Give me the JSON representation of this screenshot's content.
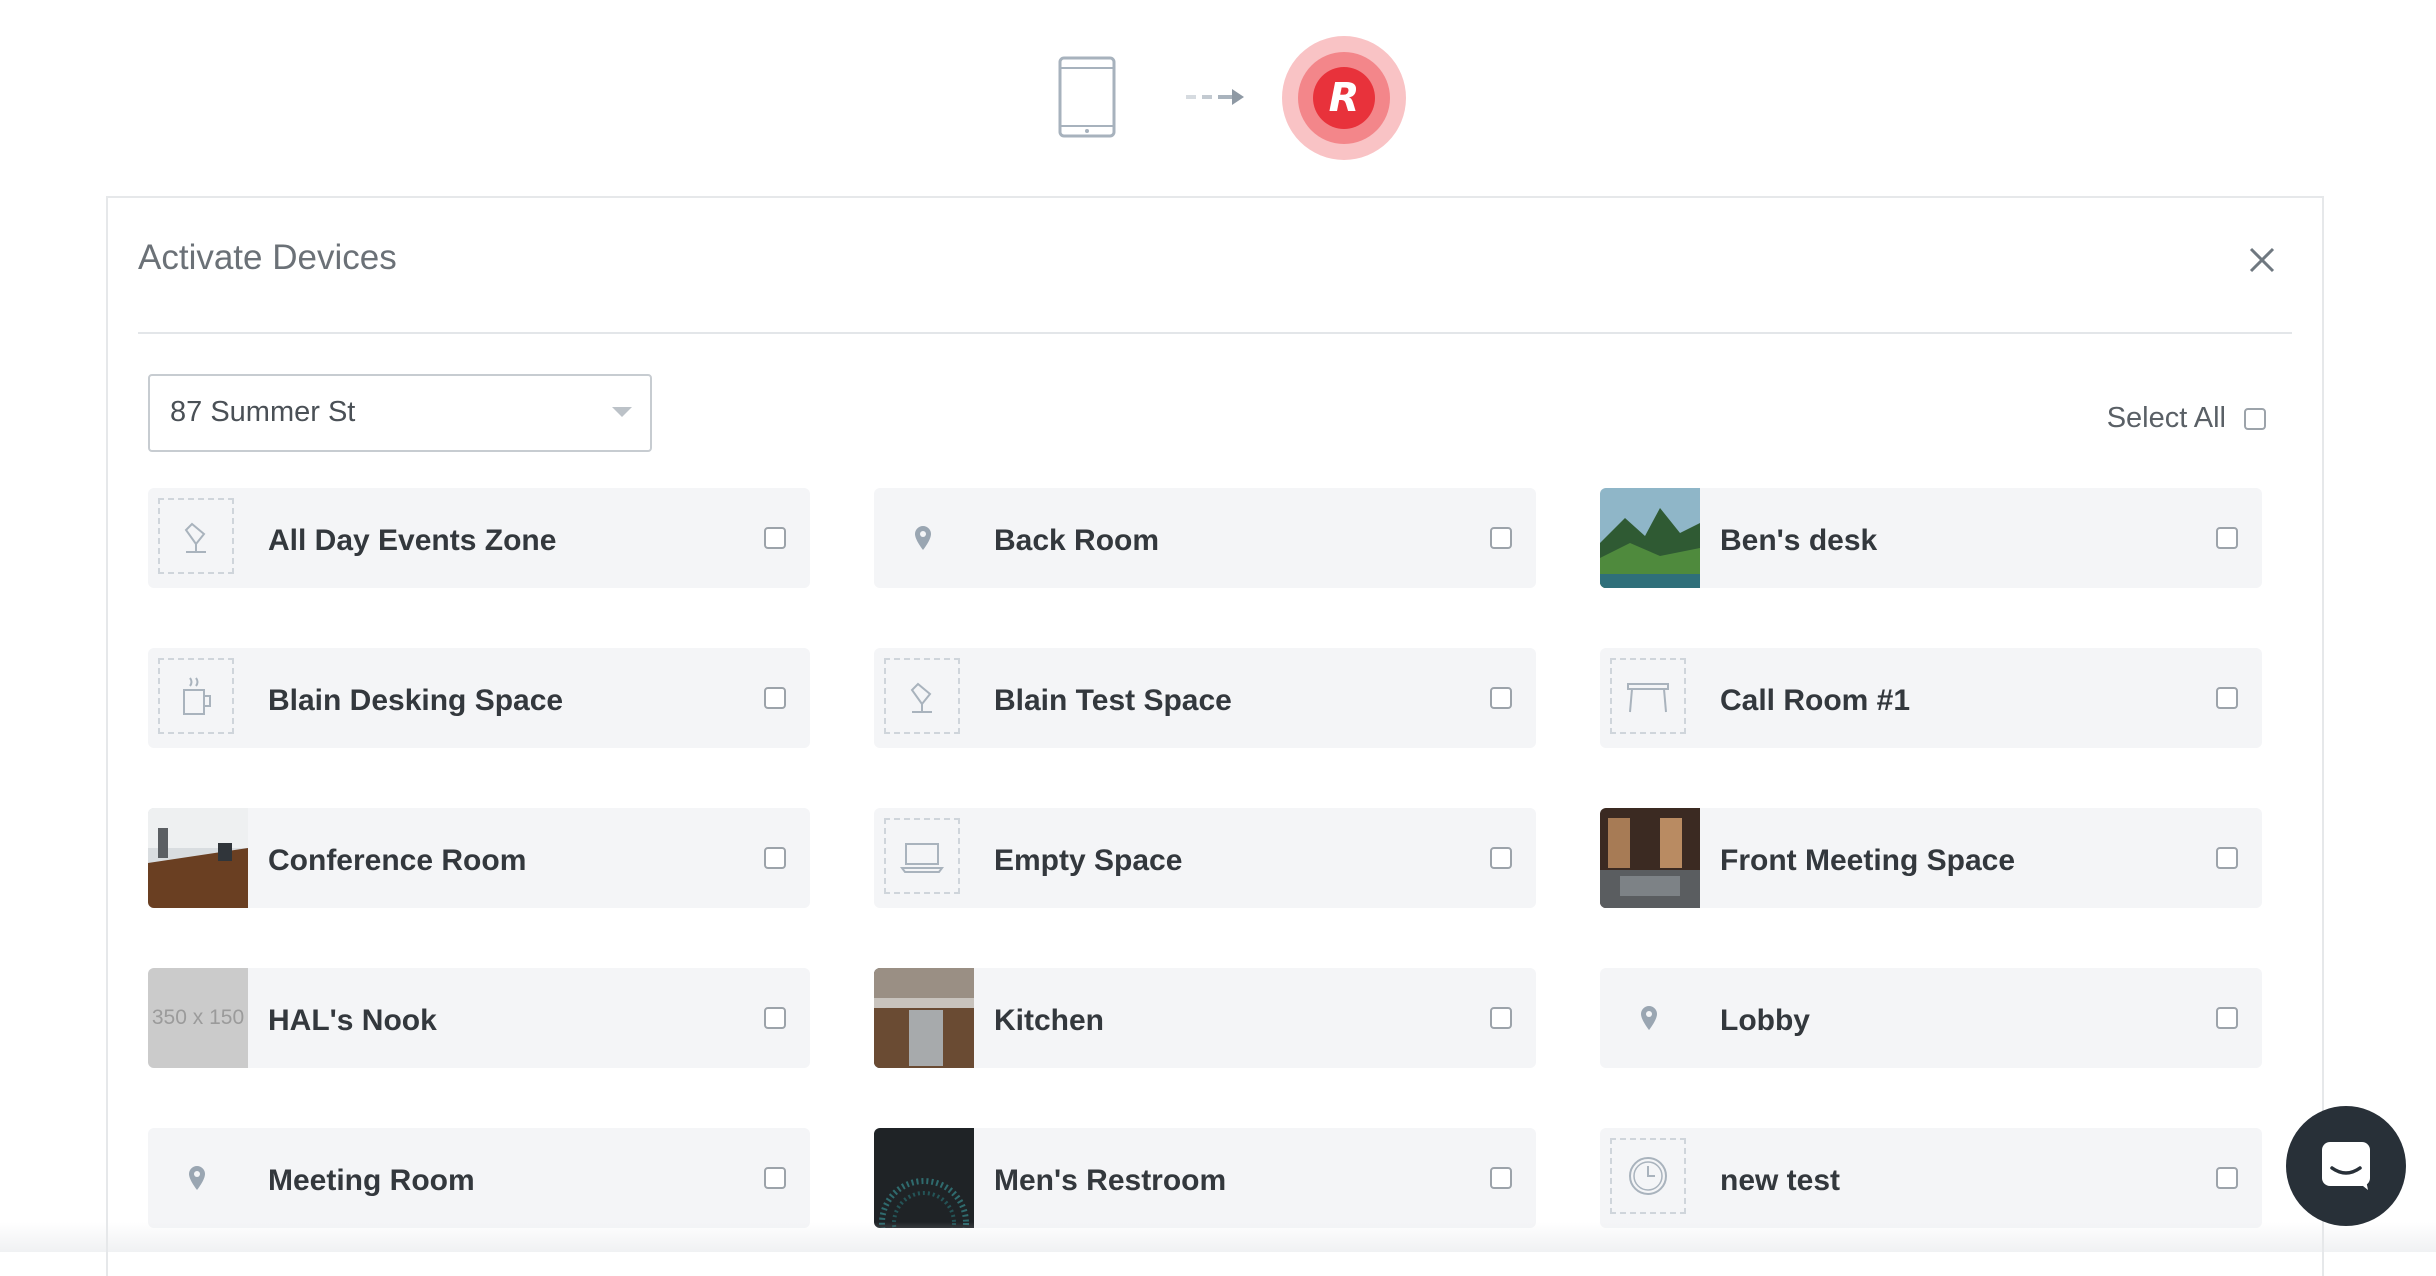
{
  "modal": {
    "title": "Activate Devices",
    "location": "87 Summer St",
    "select_all_label": "Select All"
  },
  "spaces": [
    {
      "name": "All Day Events Zone",
      "icon": "desk-lamp-icon"
    },
    {
      "name": "Back Room",
      "icon": "location-pin-icon"
    },
    {
      "name": "Ben's desk",
      "icon": "photo-landscape"
    },
    {
      "name": "Blain Desking Space",
      "icon": "coffee-cup-icon"
    },
    {
      "name": "Blain Test Space",
      "icon": "desk-lamp-icon"
    },
    {
      "name": "Call Room #1",
      "icon": "table-icon"
    },
    {
      "name": "Conference Room",
      "icon": "photo-office"
    },
    {
      "name": "Empty Space",
      "icon": "laptop-icon"
    },
    {
      "name": "Front Meeting Space",
      "icon": "photo-room"
    },
    {
      "name": "HAL's Nook",
      "icon": "placeholder-image",
      "thumb_text": "350 x 150"
    },
    {
      "name": "Kitchen",
      "icon": "photo-kitchen"
    },
    {
      "name": "Lobby",
      "icon": "location-pin-icon"
    },
    {
      "name": "Meeting Room",
      "icon": "location-pin-icon"
    },
    {
      "name": "Men's Restroom",
      "icon": "photo-dark"
    },
    {
      "name": "new test",
      "icon": "clock-icon"
    }
  ],
  "colors": {
    "brand_red": "#e8323b",
    "card_bg": "#f4f5f7",
    "chat_bg": "#283038"
  }
}
